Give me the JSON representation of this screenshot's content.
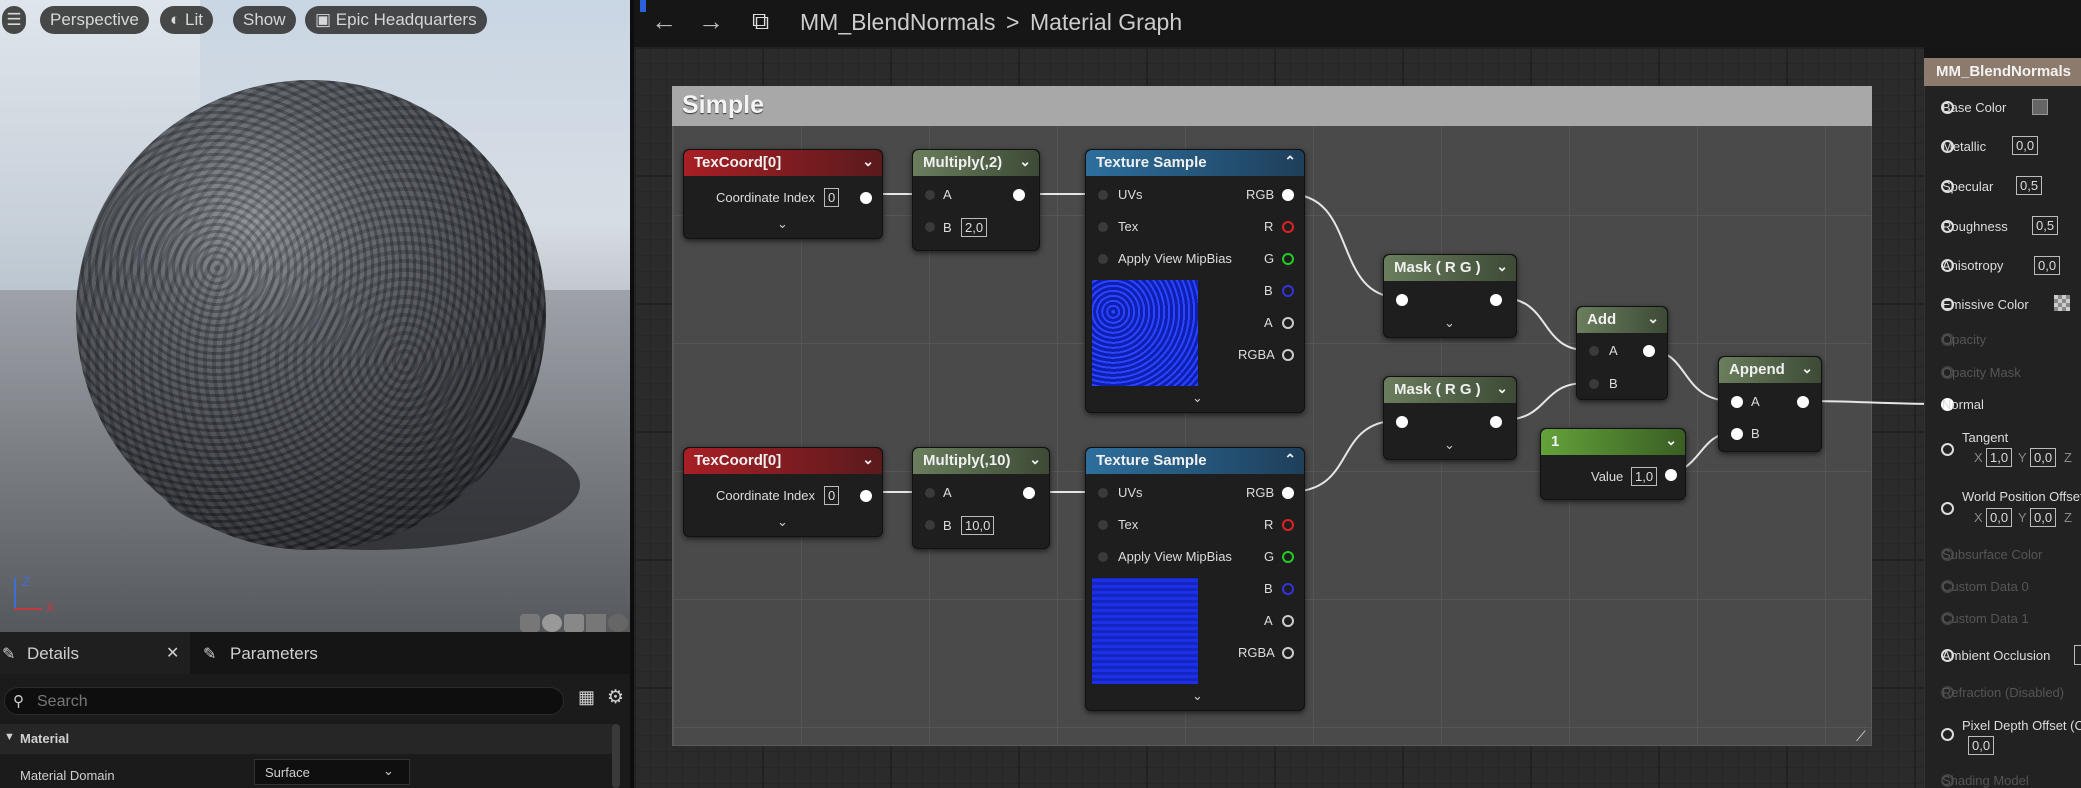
{
  "viewport": {
    "perspective": "Perspective",
    "lit": "Lit",
    "show": "Show",
    "scene": "Epic Headquarters",
    "axis_z": "Z",
    "axis_x": "X"
  },
  "details": {
    "tab_details": "Details",
    "tab_params": "Parameters",
    "search_placeholder": "Search",
    "section": "Material",
    "domain_label": "Material Domain",
    "domain_value": "Surface"
  },
  "topbar": {
    "asset": "MM_BlendNormals",
    "separator": ">",
    "graph": "Material Graph"
  },
  "comment": {
    "title": "Simple"
  },
  "nodes": {
    "tc1": {
      "title": "TexCoord[0]",
      "label": "Coordinate Index",
      "value": "0"
    },
    "tc2": {
      "title": "TexCoord[0]",
      "label": "Coordinate Index",
      "value": "0"
    },
    "mul1": {
      "title": "Multiply(,2)",
      "a": "A",
      "b": "B",
      "bval": "2,0"
    },
    "mul2": {
      "title": "Multiply(,10)",
      "a": "A",
      "b": "B",
      "bval": "10,0"
    },
    "ts1": {
      "title": "Texture Sample",
      "uvs": "UVs",
      "tex": "Tex",
      "mip": "Apply View MipBias",
      "rgb": "RGB",
      "r": "R",
      "g": "G",
      "b": "B",
      "a": "A",
      "rgba": "RGBA"
    },
    "ts2": {
      "title": "Texture Sample",
      "uvs": "UVs",
      "tex": "Tex",
      "mip": "Apply View MipBias",
      "rgb": "RGB",
      "r": "R",
      "g": "G",
      "b": "B",
      "a": "A",
      "rgba": "RGBA"
    },
    "mask1": {
      "title": "Mask ( R G )"
    },
    "mask2": {
      "title": "Mask ( R G )"
    },
    "add": {
      "title": "Add",
      "a": "A",
      "b": "B"
    },
    "append": {
      "title": "Append",
      "a": "A",
      "b": "B"
    },
    "const": {
      "title": "1",
      "label": "Value",
      "value": "1,0"
    }
  },
  "material": {
    "title": "MM_BlendNormals",
    "base_color": "Base Color",
    "metallic": "Metallic",
    "metallic_v": "0,0",
    "specular": "Specular",
    "specular_v": "0,5",
    "roughness": "Roughness",
    "roughness_v": "0,5",
    "anisotropy": "Anisotropy",
    "anisotropy_v": "0,0",
    "emissive": "Emissive Color",
    "opacity": "Opacity",
    "opacity_mask": "Opacity Mask",
    "normal": "Normal",
    "tangent": "Tangent",
    "tx": "X",
    "txv": "1,0",
    "ty": "Y",
    "tyv": "0,0",
    "tz": "Z",
    "wpo": "World Position Offset",
    "wx": "X",
    "wxv": "0,0",
    "wy": "Y",
    "wyv": "0,0",
    "wz": "Z",
    "subsurface": "Subsurface Color",
    "cd0": "Custom Data 0",
    "cd1": "Custom Data 1",
    "ao": "Ambient Occlusion",
    "refraction": "Refraction (Disabled)",
    "pdo": "Pixel Depth Offset (C",
    "pdo_v": "0,0",
    "shading": "Shading Model"
  }
}
